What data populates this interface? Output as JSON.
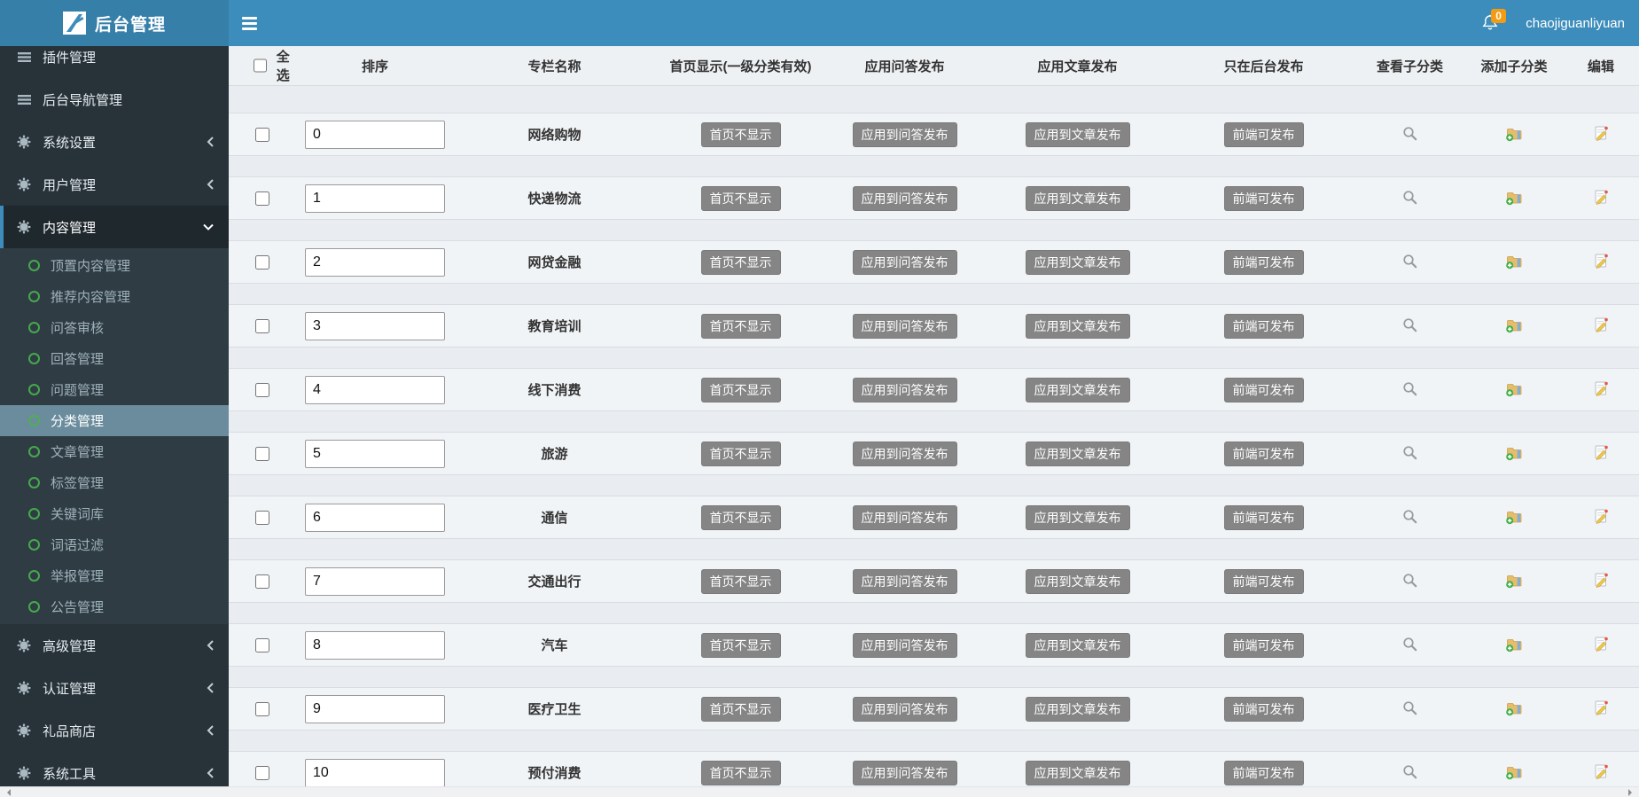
{
  "navbar": {
    "brand": "后台管理",
    "username": "chaojiguanliyuan",
    "notification_count": "0",
    "icons": [
      "grid-logo-icon",
      "hamburger-icon",
      "bell-icon"
    ]
  },
  "colors": {
    "navbar": "#3c8dbc",
    "navbar_brand": "#367fa9",
    "sidebar": "#273239",
    "submenu": "#2f3c44",
    "selected_submenu": "#6a8c9c",
    "active_border": "#3c8dbc",
    "badge": "#f39c12",
    "button_gray": "#858585",
    "content_bg": "#e9edf1",
    "row_band": "#f1f4f7",
    "submenu_dot": "#45a94c"
  },
  "sidebar": {
    "items": [
      {
        "label": "插件管理",
        "type": "top",
        "icon": "list-icon",
        "chevron": ""
      },
      {
        "label": "后台导航管理",
        "type": "top",
        "icon": "list-icon",
        "chevron": ""
      },
      {
        "label": "系统设置",
        "type": "top",
        "icon": "gear-icon",
        "chevron": "left"
      },
      {
        "label": "用户管理",
        "type": "top",
        "icon": "gear-icon",
        "chevron": "left"
      },
      {
        "label": "内容管理",
        "type": "top",
        "icon": "gear-icon",
        "chevron": "down",
        "active": true
      },
      {
        "label": "顶置内容管理",
        "type": "sub"
      },
      {
        "label": "推荐内容管理",
        "type": "sub"
      },
      {
        "label": "问答审核",
        "type": "sub"
      },
      {
        "label": "回答管理",
        "type": "sub"
      },
      {
        "label": "问题管理",
        "type": "sub"
      },
      {
        "label": "分类管理",
        "type": "sub",
        "selected": true
      },
      {
        "label": "文章管理",
        "type": "sub"
      },
      {
        "label": "标签管理",
        "type": "sub"
      },
      {
        "label": "关键词库",
        "type": "sub"
      },
      {
        "label": "词语过滤",
        "type": "sub"
      },
      {
        "label": "举报管理",
        "type": "sub"
      },
      {
        "label": "公告管理",
        "type": "sub"
      },
      {
        "label": "高级管理",
        "type": "top",
        "icon": "gear-icon",
        "chevron": "left"
      },
      {
        "label": "认证管理",
        "type": "top",
        "icon": "gear-icon",
        "chevron": "left"
      },
      {
        "label": "礼品商店",
        "type": "top",
        "icon": "gear-icon",
        "chevron": "left"
      },
      {
        "label": "系统工具",
        "type": "top",
        "icon": "gear-icon",
        "chevron": "left"
      }
    ]
  },
  "table": {
    "select_all_label": "全选",
    "headers": [
      "排序",
      "专栏名称",
      "首页显示(一级分类有效)",
      "应用问答发布",
      "应用文章发布",
      "只在后台发布",
      "查看子分类",
      "添加子分类",
      "编辑"
    ],
    "row_buttons": {
      "home": "首页不显示",
      "qa": "应用到问答发布",
      "article": "应用到文章发布",
      "backend": "前端可发布"
    },
    "action_icons": [
      "search-icon",
      "folder-plus-icon",
      "edit-pencil-icon"
    ],
    "rows": [
      {
        "sort": "0",
        "name": "网络购物"
      },
      {
        "sort": "1",
        "name": "快递物流"
      },
      {
        "sort": "2",
        "name": "网贷金融"
      },
      {
        "sort": "3",
        "name": "教育培训"
      },
      {
        "sort": "4",
        "name": "线下消费"
      },
      {
        "sort": "5",
        "name": "旅游"
      },
      {
        "sort": "6",
        "name": "通信"
      },
      {
        "sort": "7",
        "name": "交通出行"
      },
      {
        "sort": "8",
        "name": "汽车"
      },
      {
        "sort": "9",
        "name": "医疗卫生"
      },
      {
        "sort": "10",
        "name": "预付消费"
      }
    ]
  }
}
